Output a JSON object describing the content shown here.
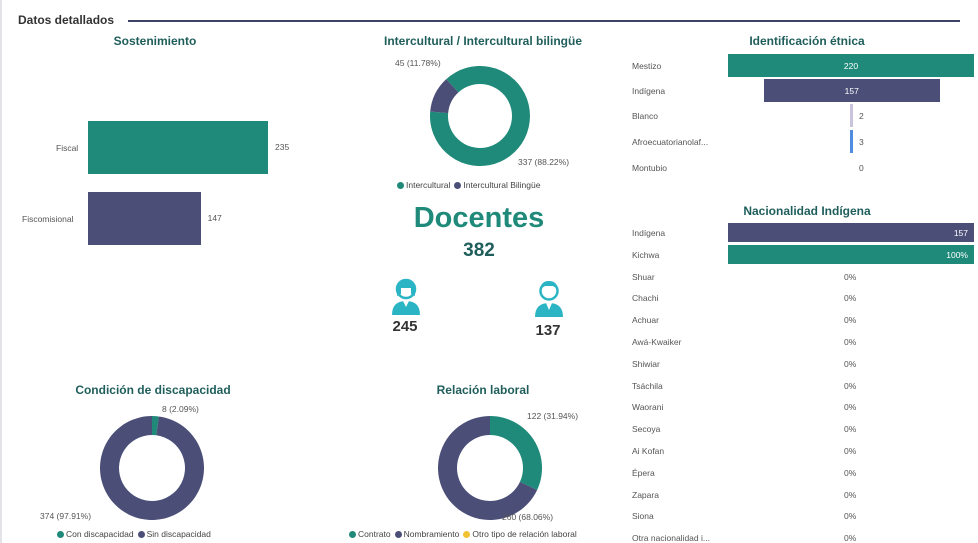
{
  "header": {
    "title": "Datos detallados"
  },
  "kpi": {
    "title": "Docentes",
    "total": "382",
    "female": "245",
    "male": "137"
  },
  "colors": {
    "teal": "#1f8a79",
    "navy": "#4b4f78",
    "yellow": "#f2c233",
    "lilac": "#c9c3dd",
    "blue": "#4f8de0"
  },
  "icons": {
    "female": "female-teacher-icon",
    "male": "male-teacher-icon"
  },
  "chart_data": [
    {
      "id": "sostenimiento",
      "type": "bar",
      "orientation": "horizontal",
      "title": "Sostenimiento",
      "categories": [
        "Fiscal",
        "Fiscomisional"
      ],
      "values": [
        235,
        147
      ],
      "value_labels": [
        "235",
        "147"
      ],
      "colors": [
        "#1f8a79",
        "#4b4f78"
      ]
    },
    {
      "id": "intercultural",
      "type": "pie",
      "donut": true,
      "title": "Intercultural / Intercultural bilingüe",
      "labels": [
        "Intercultural",
        "Intercultural Bilingüe"
      ],
      "values": [
        337,
        45
      ],
      "slice_labels": [
        "337 (88.22%)",
        "45 (11.78%)"
      ],
      "colors": [
        "#1f8a79",
        "#4b4f78"
      ]
    },
    {
      "id": "etnica",
      "type": "bar",
      "orientation": "horizontal",
      "title": "Identificación étnica",
      "categories": [
        "Mestizo",
        "Indígena",
        "Blanco",
        "Afroecuatorianolaf...",
        "Montubio"
      ],
      "values": [
        220,
        157,
        2,
        3,
        0
      ],
      "value_labels": [
        "220",
        "157",
        "2",
        "3",
        "0"
      ],
      "colors": [
        "#1f8a79",
        "#4b4f78",
        "#c9c3dd",
        "#4f8de0",
        "#1f8a79"
      ]
    },
    {
      "id": "nacionalidad",
      "type": "bar",
      "orientation": "horizontal",
      "title": "Nacionalidad Indígena",
      "categories": [
        "Indígena",
        "Kichwa",
        "Shuar",
        "Chachi",
        "Achuar",
        "Awá-Kwaiker",
        "Shiwiar",
        "Tsáchila",
        "Waorani",
        "Secoya",
        "Ai Kofan",
        "Épera",
        "Zapara",
        "Siona",
        "Otra nacionalidad i..."
      ],
      "values": [
        157,
        100,
        0,
        0,
        0,
        0,
        0,
        0,
        0,
        0,
        0,
        0,
        0,
        0,
        0
      ],
      "value_labels": [
        "157",
        "100%",
        "0%",
        "0%",
        "0%",
        "0%",
        "0%",
        "0%",
        "0%",
        "0%",
        "0%",
        "0%",
        "0%",
        "0%",
        "0%"
      ],
      "colors": [
        "#4b4f78",
        "#1f8a79"
      ]
    },
    {
      "id": "discapacidad",
      "type": "pie",
      "donut": true,
      "title": "Condición de discapacidad",
      "labels": [
        "Con discapacidad",
        "Sin discapacidad"
      ],
      "values": [
        8,
        374
      ],
      "slice_labels": [
        "8 (2.09%)",
        "374 (97.91%)"
      ],
      "colors": [
        "#1f8a79",
        "#4b4f78"
      ]
    },
    {
      "id": "relacion",
      "type": "pie",
      "donut": true,
      "title": "Relación laboral",
      "labels": [
        "Contrato",
        "Nombramiento",
        "Otro tipo de relación laboral"
      ],
      "values": [
        122,
        260,
        0
      ],
      "slice_labels": [
        "122 (31.94%)",
        "260 (68.06%)"
      ],
      "colors": [
        "#1f8a79",
        "#4b4f78",
        "#f2c233"
      ]
    }
  ]
}
